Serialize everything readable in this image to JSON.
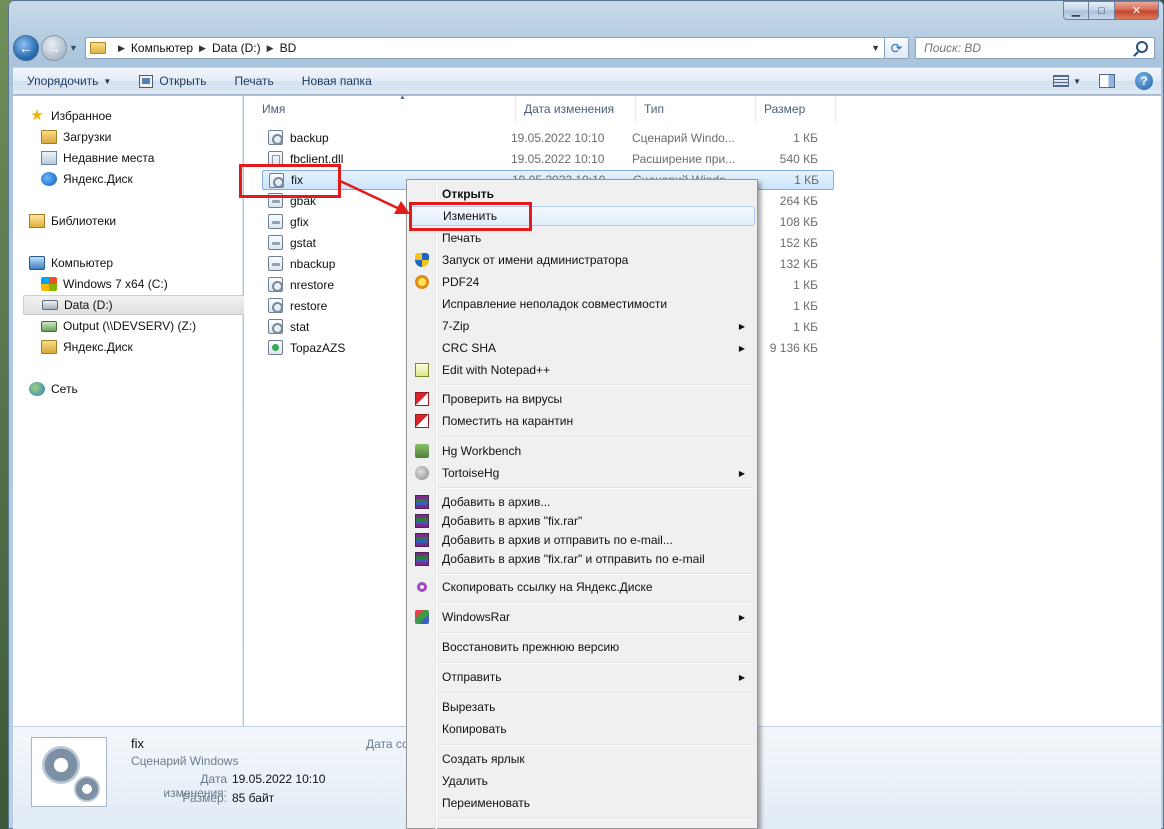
{
  "window": {
    "caption": {
      "minimize": "▁",
      "maximize": "□",
      "close": "✕"
    }
  },
  "address": {
    "crumbs": [
      "Компьютер",
      "Data (D:)",
      "BD"
    ],
    "search_placeholder": "Поиск: BD"
  },
  "toolbar": {
    "organize": "Упорядочить",
    "open": "Открыть",
    "print": "Печать",
    "new_folder": "Новая папка",
    "help": "?"
  },
  "nav": {
    "favorites": "Избранное",
    "downloads": "Загрузки",
    "recent": "Недавние места",
    "yadisk": "Яндекс.Диск",
    "libraries": "Библиотеки",
    "computer": "Компьютер",
    "drive_c": "Windows 7 x64 (C:)",
    "drive_d": "Data (D:)",
    "drive_z": "Output (\\\\DEVSERV) (Z:)",
    "yadisk2": "Яндекс.Диск",
    "network": "Сеть"
  },
  "columns": {
    "name": "Имя",
    "date": "Дата изменения",
    "type": "Тип",
    "size": "Размер"
  },
  "files": [
    {
      "name": "backup",
      "date": "19.05.2022 10:10",
      "type": "Сценарий Windo...",
      "size": "1 КБ"
    },
    {
      "name": "fbclient.dll",
      "date": "19.05.2022 10:10",
      "type": "Расширение при...",
      "size": "540 КБ"
    },
    {
      "name": "fix",
      "date": "19.05.2022 10:10",
      "type": "Сценарий Windo...",
      "size": "1 КБ"
    },
    {
      "name": "gbak",
      "date": "",
      "type": "",
      "size": "264 КБ"
    },
    {
      "name": "gfix",
      "date": "",
      "type": "",
      "size": "108 КБ"
    },
    {
      "name": "gstat",
      "date": "",
      "type": "",
      "size": "152 КБ"
    },
    {
      "name": "nbackup",
      "date": "",
      "type": "",
      "size": "132 КБ"
    },
    {
      "name": "nrestore",
      "date": "",
      "type": "",
      "size": "1 КБ"
    },
    {
      "name": "restore",
      "date": "",
      "type": "",
      "size": "1 КБ"
    },
    {
      "name": "stat",
      "date": "",
      "type": "",
      "size": "1 КБ"
    },
    {
      "name": "TopazAZS",
      "date": "",
      "type": "",
      "size": "9 136 КБ"
    }
  ],
  "details": {
    "name": "fix",
    "type": "Сценарий Windows",
    "modified_label": "Дата изменения:",
    "modified_value": "19.05.2022 10:10",
    "size_label": "Размер:",
    "size_value": "85 байт",
    "created_label": "Дата со"
  },
  "menu": {
    "open": "Открыть",
    "edit": "Изменить",
    "print": "Печать",
    "run_admin": "Запуск от имени администратора",
    "pdf24": "PDF24",
    "compat": "Исправление неполадок совместимости",
    "zip7": "7-Zip",
    "crc": "CRC SHA",
    "notepad": "Edit with Notepad++",
    "scan": "Проверить на вирусы",
    "quarantine": "Поместить на карантин",
    "hg_wb": "Hg Workbench",
    "thg": "TortoiseHg",
    "add_archive": "Добавить в архив...",
    "add_fixrar": "Добавить в архив \"fix.rar\"",
    "add_email": "Добавить в архив и отправить по e-mail...",
    "add_fixrar_email": "Добавить в архив \"fix.rar\" и отправить по e-mail",
    "yadisk_link": "Скопировать ссылку на Яндекс.Диске",
    "winrar": "WindowsRar",
    "restore_prev": "Восстановить прежнюю версию",
    "send_to": "Отправить",
    "cut": "Вырезать",
    "copy": "Копировать",
    "shortcut": "Создать ярлык",
    "delete": "Удалить",
    "rename": "Переименовать",
    "submenu_arrow": "▶"
  },
  "colors": {
    "annotation_red": "#e21b1b",
    "selection_blue": "#cce4fb"
  }
}
